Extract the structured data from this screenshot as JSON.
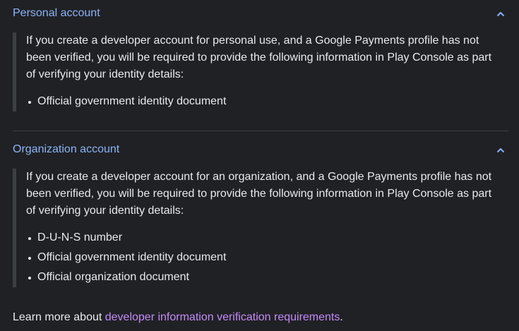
{
  "colors": {
    "background": "#202124",
    "text": "#e8eaed",
    "accordion_title": "#8ab4f8",
    "link": "#c58af9",
    "border": "#3c4043"
  },
  "sections": [
    {
      "title": "Personal account",
      "icon": "chevron-up-icon",
      "body": "If you create a developer account for personal use, and a Google Payments profile has not been verified, you will be required to provide the following information in Play Console as part of verifying your identity details:",
      "items": [
        "Official government identity document"
      ]
    },
    {
      "title": "Organization account",
      "icon": "chevron-up-icon",
      "body": "If you create a developer account for an organization, and a Google Payments profile has not been verified, you will be required to provide the following information in Play Console as part of verifying your identity details:",
      "items": [
        "D-U-N-S number",
        "Official government identity document",
        "Official organization document"
      ]
    }
  ],
  "footer": {
    "prefix": "Learn more about ",
    "link_text": "developer information verification requirements",
    "suffix": "."
  }
}
